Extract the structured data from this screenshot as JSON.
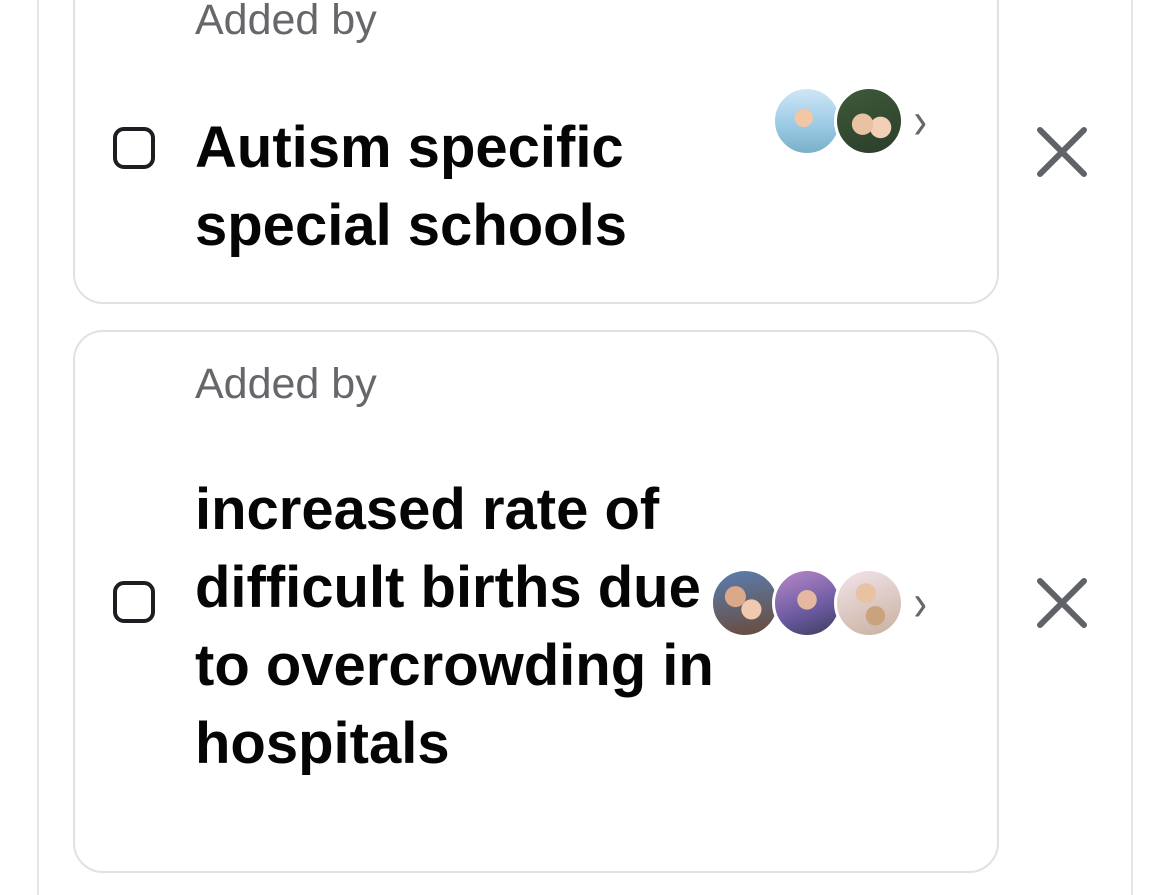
{
  "poll": {
    "options": [
      {
        "added_by_prefix": "Added by",
        "author_name": "",
        "text": "Autism specific special schools",
        "voters": [
          "profile-photo",
          "profile-photo"
        ]
      },
      {
        "added_by_prefix": "Added by",
        "author_name": "",
        "text": "increased rate of difficult births due to overcrowding in hospitals",
        "voters": [
          "profile-photo",
          "profile-photo",
          "profile-photo"
        ]
      }
    ],
    "chevron_glyph": "›",
    "icons": {
      "checkbox": "checkbox-unchecked-icon",
      "remove": "close-icon",
      "chevron": "chevron-right-icon"
    },
    "colors": {
      "text": "#050505",
      "secondary": "#65676b",
      "link": "#1877f2",
      "border": "#dfe1e6"
    }
  }
}
